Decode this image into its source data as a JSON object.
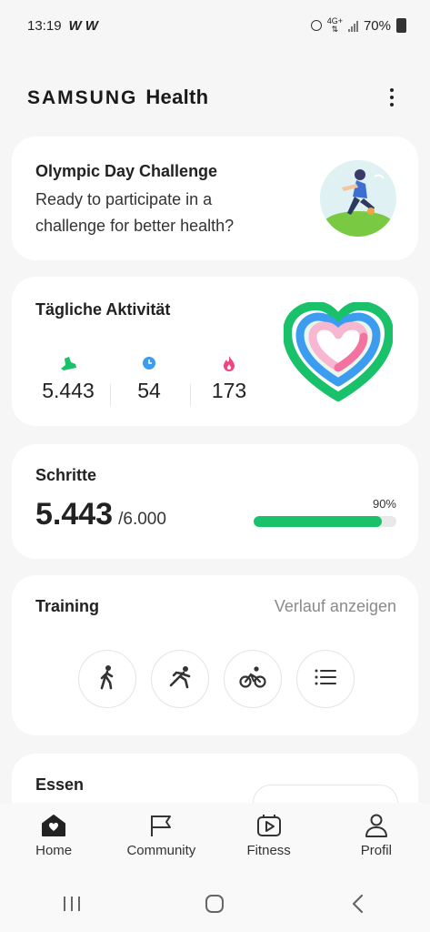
{
  "status_bar": {
    "time": "13:19",
    "notif_1": "W",
    "notif_2": "W",
    "network": "4G+",
    "battery": "70%"
  },
  "header": {
    "brand": "SAMSUNG",
    "product": "Health"
  },
  "challenge": {
    "title": "Olympic Day Challenge",
    "description": "Ready to participate in a challenge for better health?"
  },
  "activity": {
    "title": "Tägliche Aktivität",
    "steps": "5.443",
    "minutes": "54",
    "calories": "173",
    "colors": {
      "steps": "#19c16b",
      "minutes": "#3b9cf0",
      "calories": "#f0457e"
    }
  },
  "steps": {
    "title": "Schritte",
    "value": "5.443",
    "goal": "/6.000",
    "percent_label": "90%",
    "progress": 0.9,
    "color": "#19c16b"
  },
  "training": {
    "title": "Training",
    "history_link": "Verlauf anzeigen",
    "buttons": [
      "walking-icon",
      "running-icon",
      "cycling-icon",
      "list-icon"
    ]
  },
  "food": {
    "title": "Essen"
  },
  "nav": {
    "home": "Home",
    "community": "Community",
    "fitness": "Fitness",
    "profile": "Profil"
  }
}
